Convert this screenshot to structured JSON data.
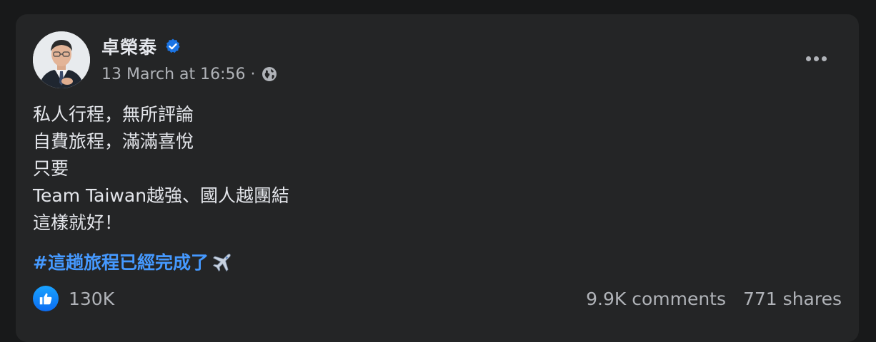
{
  "post": {
    "author": "卓榮泰",
    "verified": true,
    "timestamp": "13 March at 16:56",
    "separator": "·",
    "privacy_icon": "globe-icon",
    "lines": [
      "私人行程，無所評論",
      "自費旅程，滿滿喜悅",
      "只要",
      "Team Taiwan越強、國人越團結",
      "這樣就好！"
    ],
    "hashtag": "#這趟旅程已經完成了",
    "hashtag_emoji": "airplane-icon"
  },
  "stats": {
    "likes": "130K",
    "comments": "9.9K comments",
    "shares": "771 shares"
  },
  "colors": {
    "background": "#18191a",
    "card": "#242526",
    "primary_text": "#e4e6eb",
    "secondary_text": "#b0b3b8",
    "link": "#4599ff",
    "like_blue": "#0b6cf2"
  }
}
